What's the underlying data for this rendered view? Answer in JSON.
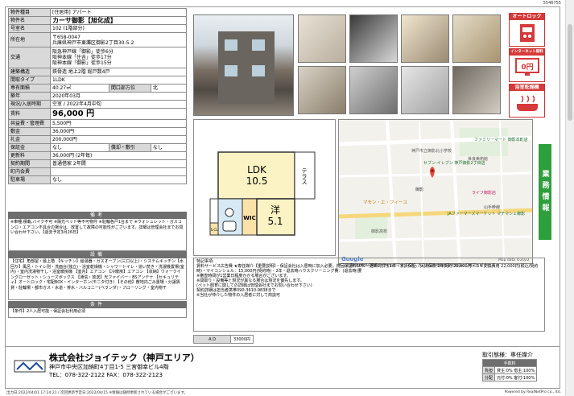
{
  "doc_id": "5546755",
  "spec": {
    "rows": [
      {
        "label": "物件種目",
        "value": "[住居用] アパート"
      },
      {
        "label": "物件名",
        "value": "カーサ御影【旭化成】"
      },
      {
        "label": "号室名",
        "value": "102 (1階部分)"
      },
      {
        "label": "所在地",
        "value": "〒658-0047\n兵庫県神戸市東灘区御影2丁目30-5-2"
      },
      {
        "label": "交通",
        "value": "阪急神戸線「御影」徒歩6分\n阪神本線「住吉」徒歩17分\n阪神本線「御影」徒歩15分"
      },
      {
        "label": "建築構造",
        "value": "鉄骨造 地上2階 総戸数4戸"
      },
      {
        "label": "間取タイプ",
        "value": "1LDK"
      },
      {
        "label": "専有面積",
        "value": "40.27㎡",
        "extra_label": "間口部方位",
        "extra_value": "北"
      },
      {
        "label": "築年",
        "value": "2020年03月"
      },
      {
        "label": "現況/入居時期",
        "value": "空室 / 2022年4月中旬"
      },
      {
        "label": "賃料",
        "value": "96,000 円"
      },
      {
        "label": "共益費・管理費",
        "value": "5,500円"
      },
      {
        "label": "敷金",
        "value": "36,000円"
      },
      {
        "label": "礼金",
        "value": "200,000円"
      },
      {
        "label": "保証金",
        "value": "なし",
        "extra_label": "償却・敷引",
        "extra_value": "なし"
      },
      {
        "label": "更新料",
        "value": "36,000円 (2年毎)"
      },
      {
        "label": "契約期間",
        "value": "普通借家 2年間"
      },
      {
        "label": "町内会費",
        "value": ""
      },
      {
        "label": "駐車場",
        "value": "なし"
      }
    ]
  },
  "bikou": {
    "title": "備考",
    "text": "※車種,積載,バイク不可 ※陽光ペット等不可物件 ※駐輪各戸1台まで ※ウォシュレット・ガスコンロ・エアコン不具合の場合は、放置して故障の可能性がございます。詳細は管理会社までお問い合わせ下さい。【退去予定3月26日】"
  },
  "setsubi": {
    "title": "設備",
    "text": "【住宅】角部屋・最上階 【キッチン】給湯器・ガスオーブン(三口以上)・システムキッチン【水回り】風呂・トイレ別・洗面台(独立)・浴室乾燥機・シャワートイレ・追い焚き・洗濯機置場(室内)・室内洗濯物干し・浴室暖房機 【室内】エアコン 【冷暖房】エアコン 【収納】ウォークインクローゼット・シューズボックス 【通信・放送】光ファイバー・BSアンテナ 【セキュリティ】オートロック・宅配BOX・インターホン(モニタ付き) 【その他】敷地内ごみ置場・分譲賃貸・駐輪場・都市ガス・水道・排水・バルコニー(ベランダ)・フローリング・室内物干"
  },
  "jouken": {
    "title": "条件",
    "text": "【条件】2人入居可能・保証会社利用必須"
  },
  "amenities": [
    {
      "title": "オートロック"
    },
    {
      "title": "インターネット無料",
      "badge": "0円"
    },
    {
      "title": "浴室乾燥機"
    }
  ],
  "floorplan": {
    "ldk_label": "LDK",
    "ldk_size": "10.5",
    "west_label": "洋",
    "west_size": "5.1",
    "terrace": "テラス",
    "wic": "WIC",
    "shoe": "S.CL"
  },
  "map": {
    "labels": [
      "セブン-イレブン 神戸御影2丁目店",
      "ファミリーマート 御影本町店",
      "マモン・エ・フィーユ",
      "JAファーマーズマーケット マチマシェ御影",
      "ライフ御影店",
      "御影",
      "神戸市立御影北小学校",
      "御影高校",
      "世良美術館",
      "山手幹線",
      "Google"
    ],
    "note": "※ この資料は物件の概略を示すものです。写真・周辺施設の情報は参考程度にご確認ください。",
    "map_data": "Map data ©2022"
  },
  "side_tab": "業務情報",
  "remarks": {
    "title": "特記事項:",
    "text": "賃料サービス広告費 ★専任媒介【重要説明】・保証会社は入居時に加入必要。初回保証料50%・更新2万円/2年・家賃保証、火災保険 2年契約 20,400円・カギ交換費用 22,000円(税込/契約時)・マイコンシェル：15,000円(契約時)・2年・退去時ハウスクリーニング費：(退去時)要",
    "text2": "※審査時間が1営業日程度かかる場合がございます。\n※間取り・設備等と現況が異なる場合は現況を優先します。\n(ペット飼育に関しての詳細は管理会社までお問い合わせ下さい)\n契約詳細は担当者携帯090-3610-9838まで\n※当社が仲介した物件の入居者に対して商談可"
  },
  "ad": {
    "label": "A D",
    "value": "33000円"
  },
  "company": {
    "name": "株式会社ジョイテック（神戸エリア）",
    "address": "神戸市中央区加納町4丁目1-5 三宮御幸ビル4階",
    "tel": "TEL：078-322-2122  FAX：078-322-2123"
  },
  "deal": {
    "title": "取引態様：専任媒介",
    "header": "手数料",
    "rows": [
      {
        "label": "負担",
        "value": "貸主:0% 借主:100%"
      },
      {
        "label": "分配",
        "value": "元付:0% 客付:100%"
      }
    ]
  },
  "footer": {
    "meta": "出力日:2022/04/01 17:24:21 / 次回更新予定日:2022/04/15 ※情報は随時更新されている場合がございます。",
    "powered": "Powered by RealNetPro co., ltd."
  }
}
